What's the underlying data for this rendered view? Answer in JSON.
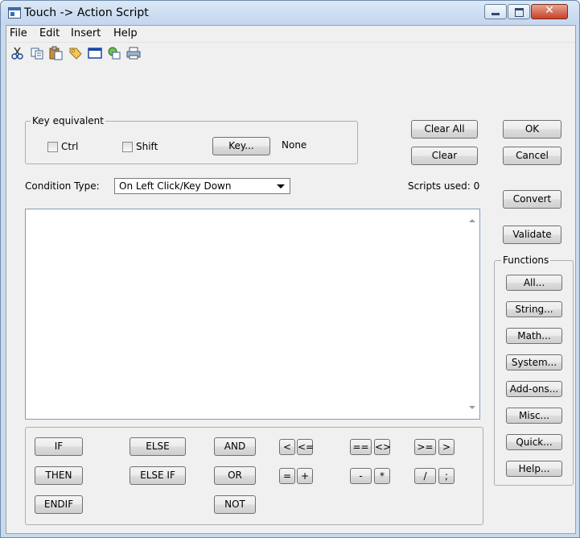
{
  "window": {
    "title": "Touch -> Action Script"
  },
  "menu": [
    "File",
    "Edit",
    "Insert",
    "Help"
  ],
  "toolbar": {
    "icons": [
      "cut-icon",
      "copy-icon",
      "paste-icon",
      "tag-icon",
      "window-icon",
      "object-icon",
      "print-icon"
    ]
  },
  "key_equivalent": {
    "label": "Key equivalent",
    "ctrl": "Ctrl",
    "shift": "Shift",
    "key_button": "Key...",
    "key_value": "None"
  },
  "buttons": {
    "clear_all": "Clear All",
    "clear": "Clear",
    "ok": "OK",
    "cancel": "Cancel",
    "convert": "Convert",
    "validate": "Validate"
  },
  "condition": {
    "label": "Condition Type:",
    "value": "On Left Click/Key Down"
  },
  "scripts_used": "Scripts used: 0",
  "functions": {
    "label": "Functions",
    "items": [
      "All...",
      "String...",
      "Math...",
      "System...",
      "Add-ons...",
      "Misc...",
      "Quick...",
      "Help..."
    ]
  },
  "keywords": {
    "if": "IF",
    "then": "THEN",
    "endif": "ENDIF",
    "else": "ELSE",
    "else_if": "ELSE IF",
    "and": "AND",
    "or": "OR",
    "not": "NOT"
  },
  "operators": {
    "lt": "<",
    "le": "<=",
    "eq": "==",
    "ne": "<>",
    "ge": ">=",
    "gt": ">",
    "assign": "=",
    "plus": "+",
    "minus": "-",
    "mul": "*",
    "div": "/",
    "semicolon": ";"
  }
}
